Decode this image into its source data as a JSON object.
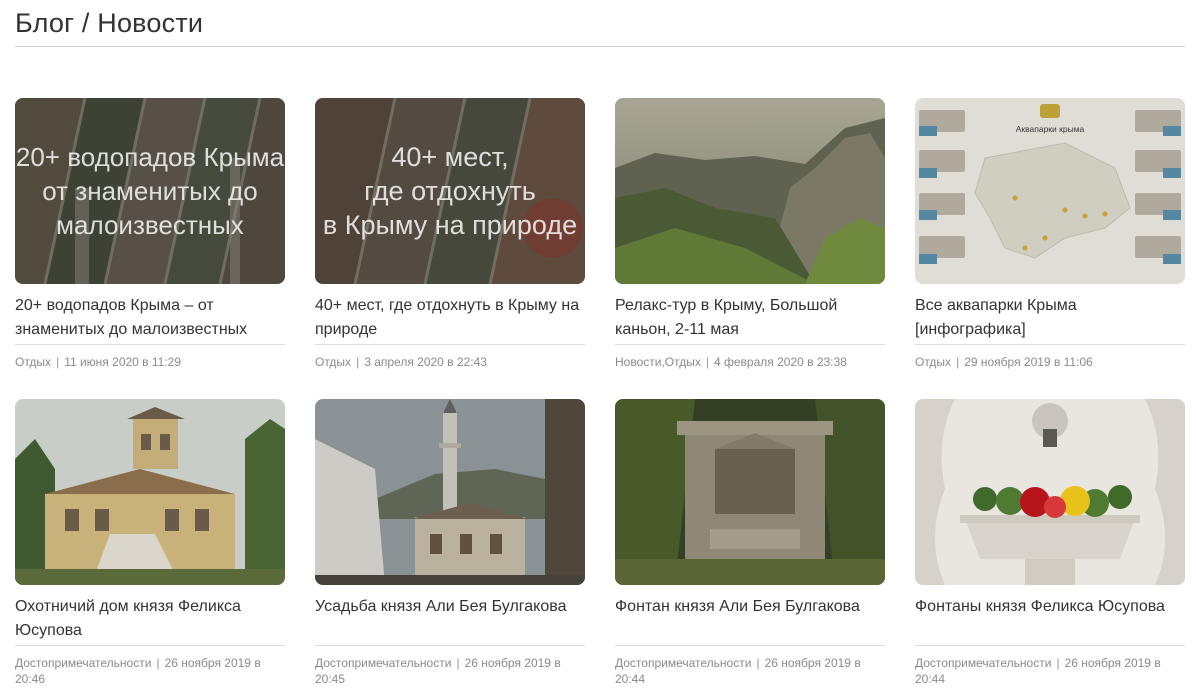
{
  "page": {
    "title": "Блог / Новости"
  },
  "posts": [
    {
      "overlay": "20+ водопадов Крыма\nот знаменитых до\nмалоизвестных",
      "title": "20+ водопадов Крыма – от знаменитых до малоизвестных",
      "category": "Отдых",
      "sep": "|",
      "date": "11 июня 2020 в 11:29",
      "image": "waterfall-collage"
    },
    {
      "overlay": "40+ мест,\nгде отдохнуть\nв Крыму на природе",
      "title": "40+ мест, где отдохнуть в Крыму на природе",
      "category": "Отдых",
      "sep": "|",
      "date": "3 апреля 2020 в 22:43",
      "image": "nature-collage"
    },
    {
      "overlay": "",
      "title": "Релакс-тур в Крыму, Большой каньон, 2-11 мая",
      "category": "Новости,Отдых",
      "sep": "|",
      "date": "4 февраля 2020 в 23:38",
      "image": "canyon-photo"
    },
    {
      "overlay": "",
      "title": "Все аквапарки Крыма [инфографика]",
      "category": "Отдых",
      "sep": "|",
      "date": "29 ноября 2019 в 11:06",
      "image": "aquaparks-infographic",
      "infographic_heading": "Аквапарки крыма"
    },
    {
      "overlay": "",
      "title": "Охотничий дом князя Феликса Юсупова",
      "category": "Достопримечательности",
      "sep": "|",
      "date": "26 ноября 2019 в 20:46",
      "image": "hunting-house-photo"
    },
    {
      "overlay": "",
      "title": "Усадьба князя Али Бея Булгакова",
      "category": "Достопримечательности",
      "sep": "|",
      "date": "26 ноября 2019 в 20:45",
      "image": "minaret-photo"
    },
    {
      "overlay": "",
      "title": "Фонтан князя Али Бея Булгакова",
      "category": "Достопримечательности",
      "sep": "|",
      "date": "26 ноября 2019 в 20:44",
      "image": "stone-fountain-photo"
    },
    {
      "overlay": "",
      "title": "Фонтаны князя Феликса Юсупова",
      "category": "Достопримечательности",
      "sep": "|",
      "date": "26 ноября 2019 в 20:44",
      "image": "flower-fountain-photo"
    }
  ]
}
